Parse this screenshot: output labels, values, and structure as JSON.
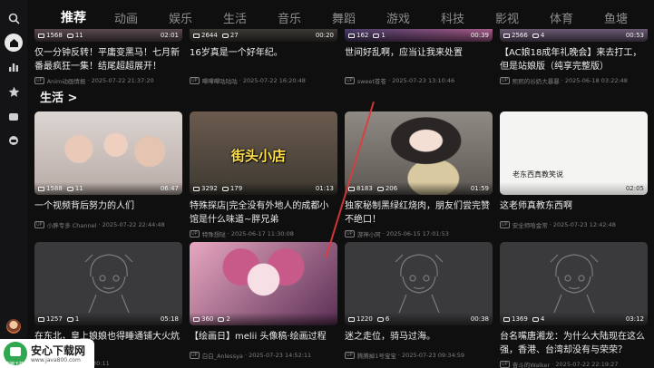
{
  "tabs": [
    "推荐",
    "动画",
    "娱乐",
    "生活",
    "音乐",
    "舞蹈",
    "游戏",
    "科技",
    "影视",
    "体育",
    "鱼塘"
  ],
  "active_tab": "推荐",
  "section_title": "生活 >",
  "top_row": [
    {
      "views": "1568",
      "comments": "11",
      "duration": "02:01",
      "title": "仅一分钟反转！平庸变黑马！七月新番最疯狂一集！结尾超超展开！",
      "author": "2025-07-22 21:37:20",
      "author_name": "Anim动画情报"
    },
    {
      "views": "2644",
      "comments": "27",
      "duration": "00:20",
      "title": "16岁真是一个好年纪。",
      "author_name": "嗶嗶嗶咕咕咕",
      "date": "2025-07-22 16:20:48"
    },
    {
      "views": "162",
      "comments": "1",
      "duration": "00:39",
      "title": "世间好乱啊，应当让我来处置",
      "author_name": "sweet苍苍",
      "date": "2025-07-23 13:10:46"
    },
    {
      "views": "2566",
      "comments": "4",
      "duration": "00:53",
      "title": "【AC娘18成年礼晚会】来去打工，但是站娘版（纯享完整版）",
      "author_name": "熙熙的谷奶大暴暴",
      "date": "2025-06-18 03:22:48"
    }
  ],
  "life_row": [
    {
      "views": "1588",
      "comments": "11",
      "duration": "06:47",
      "title": "一个视频背后努力的人们",
      "author_name": "小胖专多 Channel",
      "date": "2025-07-22 22:44:48"
    },
    {
      "views": "3292",
      "comments": "179",
      "duration": "01:13",
      "title": "特殊探店|完全没有外地人的成都小馆是什么味道~胖兄弟",
      "author_name": "特殊想哒",
      "date": "2025-06-17 11:30:08",
      "overlay_text": "街头小店"
    },
    {
      "views": "8183",
      "comments": "206",
      "duration": "01:59",
      "title": "独家秘制黑绿红烧肉，朋友们尝完赞不绝口！",
      "author_name": "游神小阿",
      "date": "2025-06-15 17:01:53"
    },
    {
      "views": "",
      "comments": "",
      "duration": "02:05",
      "title": "这老师真教东西啊",
      "author_name": "安全师哈金常",
      "date": "2025-07-23 12:42:48",
      "overlay_text": "老东西真教笑说"
    }
  ],
  "bottom_row": [
    {
      "views": "1257",
      "comments": "1",
      "duration": "05:18",
      "title": "在东北，皇上娘娘也得睡通铺大火炕",
      "author_name": "",
      "date": "2025-07-23 02:30:11"
    },
    {
      "views": "360",
      "comments": "2",
      "duration": "",
      "title": "【绘画日】melii 头像稿·绘画过程",
      "author_name": "白白_Anlessya",
      "date": "2025-07-23 14:52:11"
    },
    {
      "views": "1220",
      "comments": "6",
      "duration": "00:38",
      "title": "迷之走位，骑马过海。",
      "author_name": "腾腾掉1号宝宝",
      "date": "2025-07-23 09:34:59"
    },
    {
      "views": "1369",
      "comments": "4",
      "duration": "03:12",
      "title": "台名嘴唐湘龙：为什么大陆现在这么强，香港、台湾却没有与荣荣？",
      "author_name": "奋斗的Walker",
      "date": "2025-07-22 22:19:27"
    }
  ],
  "logo": {
    "name": "安心下载网",
    "url": "www.java800.com",
    "sub": "电脑下载"
  },
  "icons": [
    "search-icon",
    "home-icon",
    "ranking-icon",
    "star-icon",
    "message-icon",
    "bilibili-icon"
  ]
}
